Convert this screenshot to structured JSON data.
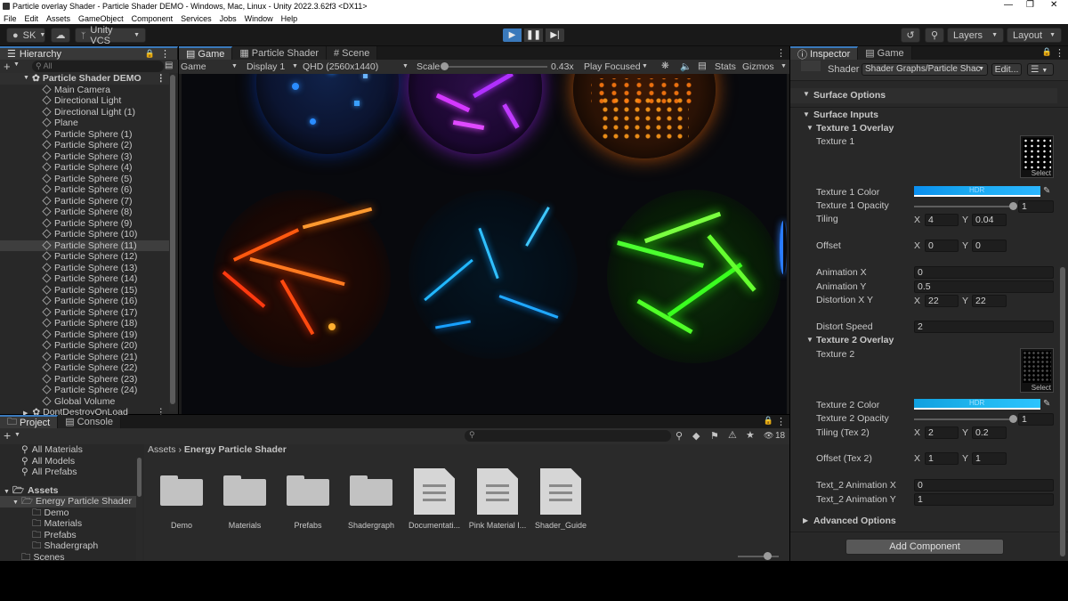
{
  "window": {
    "title": "Particle overlay Shader - Particle Shader DEMO - Windows, Mac, Linux - Unity 2022.3.62f3 <DX11>"
  },
  "menu": [
    "File",
    "Edit",
    "Assets",
    "GameObject",
    "Component",
    "Services",
    "Jobs",
    "Window",
    "Help"
  ],
  "toolbar": {
    "account": "SK",
    "vcs": "Unity VCS",
    "layers": "Layers",
    "layout": "Layout"
  },
  "hierarchy": {
    "tab": "Hierarchy",
    "search_placeholder": "All",
    "scene": "Particle Shader DEMO",
    "items": [
      "Main Camera",
      "Directional Light",
      "Directional Light (1)",
      "Plane",
      "Particle Sphere (1)",
      "Particle Sphere (2)",
      "Particle Sphere (3)",
      "Particle Sphere (4)",
      "Particle Sphere (5)",
      "Particle Sphere (6)",
      "Particle Sphere (7)",
      "Particle Sphere (8)",
      "Particle Sphere (9)",
      "Particle Sphere (10)",
      "Particle Sphere (11)",
      "Particle Sphere (12)",
      "Particle Sphere (13)",
      "Particle Sphere (14)",
      "Particle Sphere (15)",
      "Particle Sphere (16)",
      "Particle Sphere (17)",
      "Particle Sphere (18)",
      "Particle Sphere (19)",
      "Particle Sphere (20)",
      "Particle Sphere (21)",
      "Particle Sphere (22)",
      "Particle Sphere (23)",
      "Particle Sphere (24)",
      "Global Volume"
    ],
    "selected": "Particle Sphere (11)",
    "dontdestroy": "DontDestroyOnLoad"
  },
  "center_tabs": [
    "Game",
    "Particle Shader",
    "Scene"
  ],
  "game_bar": {
    "mode": "Game",
    "display": "Display 1",
    "resolution": "QHD (2560x1440)",
    "scale_label": "Scale",
    "scale_value": "0.43x",
    "scale_fraction": 0.0,
    "play_mode": "Play Focused",
    "stats": "Stats",
    "gizmos": "Gizmos"
  },
  "inspector": {
    "tabs": [
      "Inspector",
      "Game"
    ],
    "shader_label": "Shader",
    "shader_value": "Shader Graphs/Particle Shac",
    "edit_button": "Edit...",
    "sections": {
      "surface_options": "Surface Options",
      "surface_inputs": "Surface Inputs",
      "tex1_overlay": "Texture 1 Overlay",
      "tex2_overlay": "Texture 2 Overlay",
      "advanced": "Advanced Options"
    },
    "texture1": "Texture 1",
    "texture2": "Texture 2",
    "select": "Select",
    "hdr": "HDR",
    "tex1_color": "Texture 1 Color",
    "tex1_opacity": "Texture 1 Opacity",
    "tex1_opacity_value": "1",
    "tex1_opacity_fraction": 1.0,
    "tiling": "Tiling",
    "tiling_x": "4",
    "tiling_y": "0.04",
    "offset": "Offset",
    "offset_x": "0",
    "offset_y": "0",
    "anim_x": "Animation X",
    "anim_x_value": "0",
    "anim_y": "Animation Y",
    "anim_y_value": "0.5",
    "distortion": "Distortion X Y",
    "distortion_x": "22",
    "distortion_y": "22",
    "distort_speed": "Distort Speed",
    "distort_speed_value": "2",
    "tex2_color": "Texture 2 Color",
    "tex2_opacity": "Texture 2 Opacity",
    "tex2_opacity_value": "1",
    "tex2_opacity_fraction": 1.0,
    "tiling2": "Tiling (Tex 2)",
    "tiling2_x": "2",
    "tiling2_y": "0.2",
    "offset2": "Offset (Tex 2)",
    "offset2_x": "1",
    "offset2_y": "1",
    "t2ax": "Text_2 Animation X",
    "t2ax_value": "0",
    "t2ay": "Text_2 Animation Y",
    "t2ay_value": "1",
    "add_component": "Add Component",
    "x": "X",
    "y": "Y"
  },
  "project": {
    "tabs": [
      "Project",
      "Console"
    ],
    "favorites": [
      "All Materials",
      "All Models",
      "All Prefabs"
    ],
    "assets_root": "Assets",
    "tree": [
      "Energy Particle Shader",
      "Demo",
      "Materials",
      "Prefabs",
      "Shadergraph",
      "Scenes"
    ],
    "breadcrumb": [
      "Assets",
      "Energy Particle Shader"
    ],
    "hidden_count": "18",
    "items": [
      {
        "name": "Demo",
        "kind": "folder"
      },
      {
        "name": "Materials",
        "kind": "folder"
      },
      {
        "name": "Prefabs",
        "kind": "folder"
      },
      {
        "name": "Shadergraph",
        "kind": "folder"
      },
      {
        "name": "Documentati...",
        "kind": "doc"
      },
      {
        "name": "Pink Material I...",
        "kind": "doc"
      },
      {
        "name": "Shader_Guide",
        "kind": "doc"
      }
    ]
  },
  "colors": {
    "accent": "#3a79bb",
    "tex1_hdr": "#19a8f0",
    "tex2_hdr": "#1fb6ee"
  }
}
